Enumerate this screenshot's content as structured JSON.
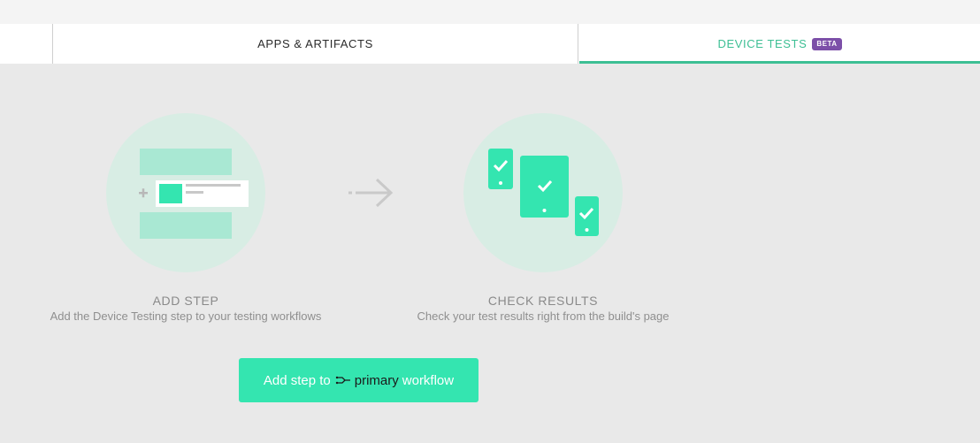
{
  "tabs": {
    "apps": "APPS & ARTIFACTS",
    "device": "DEVICE TESTS",
    "beta": "BETA"
  },
  "steps": [
    {
      "title": "ADD STEP",
      "desc": "Add the Device Testing step to your testing workflows"
    },
    {
      "title": "CHECK RESULTS",
      "desc": "Check your test results right from the build's page"
    }
  ],
  "cta": {
    "prefix": "Add step to",
    "workflow": "primary",
    "suffix": "workflow"
  },
  "colors": {
    "accent": "#3dbf94",
    "button": "#34e5b0",
    "beta": "#7c4fa8",
    "circle": "#d9ede5"
  }
}
